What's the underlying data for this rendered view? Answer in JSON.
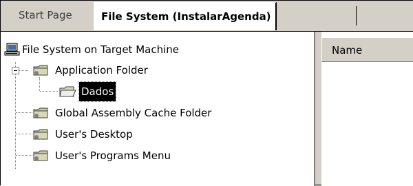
{
  "tabs": [
    {
      "label": "Start Page",
      "active": false
    },
    {
      "label": "File System (InstalarAgenda)",
      "active": true
    }
  ],
  "tree": {
    "root": {
      "label": "File System on Target Machine",
      "icon": "computer-icon"
    },
    "items": [
      {
        "label": "Application Folder",
        "icon": "folder-icon",
        "expanded": true
      },
      {
        "label": "Dados",
        "icon": "open-folder-icon",
        "selected": true
      },
      {
        "label": "Global Assembly Cache Folder",
        "icon": "folder-icon"
      },
      {
        "label": "User's Desktop",
        "icon": "folder-icon"
      },
      {
        "label": "User's Programs Menu",
        "icon": "folder-icon"
      }
    ]
  },
  "list": {
    "columns": [
      "Name"
    ]
  },
  "colors": {
    "chrome": "#d4d0c8",
    "selection_bg": "#000000",
    "selection_fg": "#ffffff"
  }
}
